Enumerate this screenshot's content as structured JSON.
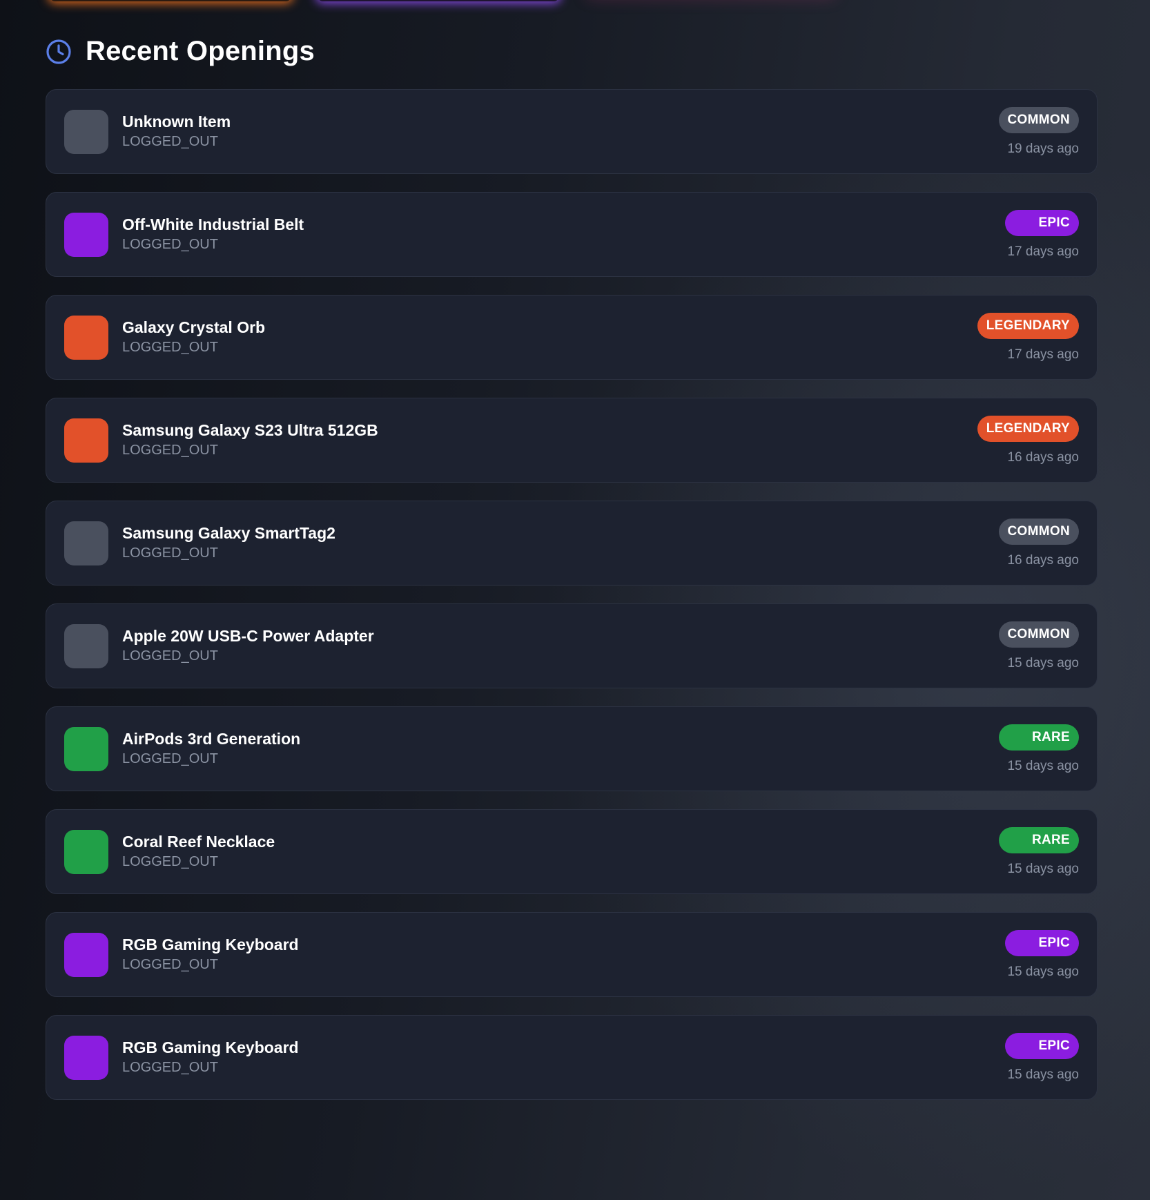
{
  "colors": {
    "common": "#4a505e",
    "epic": "#8b1de0",
    "legendary": "#e2512a",
    "rare": "#21a048",
    "clock_accent": "#5b7fe8"
  },
  "section": {
    "title": "Recent Openings",
    "icon": "clock-icon"
  },
  "openings": [
    {
      "name": "Unknown Item",
      "user": "LOGGED_OUT",
      "rarity": "COMMON",
      "rarity_key": "common",
      "time": "19 days ago"
    },
    {
      "name": "Off-White Industrial Belt",
      "user": "LOGGED_OUT",
      "rarity": "EPIC",
      "rarity_key": "epic",
      "time": "17 days ago"
    },
    {
      "name": "Galaxy Crystal Orb",
      "user": "LOGGED_OUT",
      "rarity": "LEGENDARY",
      "rarity_key": "legendary",
      "time": "17 days ago"
    },
    {
      "name": "Samsung Galaxy S23 Ultra 512GB",
      "user": "LOGGED_OUT",
      "rarity": "LEGENDARY",
      "rarity_key": "legendary",
      "time": "16 days ago"
    },
    {
      "name": "Samsung Galaxy SmartTag2",
      "user": "LOGGED_OUT",
      "rarity": "COMMON",
      "rarity_key": "common",
      "time": "16 days ago"
    },
    {
      "name": "Apple 20W USB-C Power Adapter",
      "user": "LOGGED_OUT",
      "rarity": "COMMON",
      "rarity_key": "common",
      "time": "15 days ago"
    },
    {
      "name": "AirPods 3rd Generation",
      "user": "LOGGED_OUT",
      "rarity": "RARE",
      "rarity_key": "rare",
      "time": "15 days ago"
    },
    {
      "name": "Coral Reef Necklace",
      "user": "LOGGED_OUT",
      "rarity": "RARE",
      "rarity_key": "rare",
      "time": "15 days ago"
    },
    {
      "name": "RGB Gaming Keyboard",
      "user": "LOGGED_OUT",
      "rarity": "EPIC",
      "rarity_key": "epic",
      "time": "15 days ago"
    },
    {
      "name": "RGB Gaming Keyboard",
      "user": "LOGGED_OUT",
      "rarity": "EPIC",
      "rarity_key": "epic",
      "time": "15 days ago"
    }
  ]
}
